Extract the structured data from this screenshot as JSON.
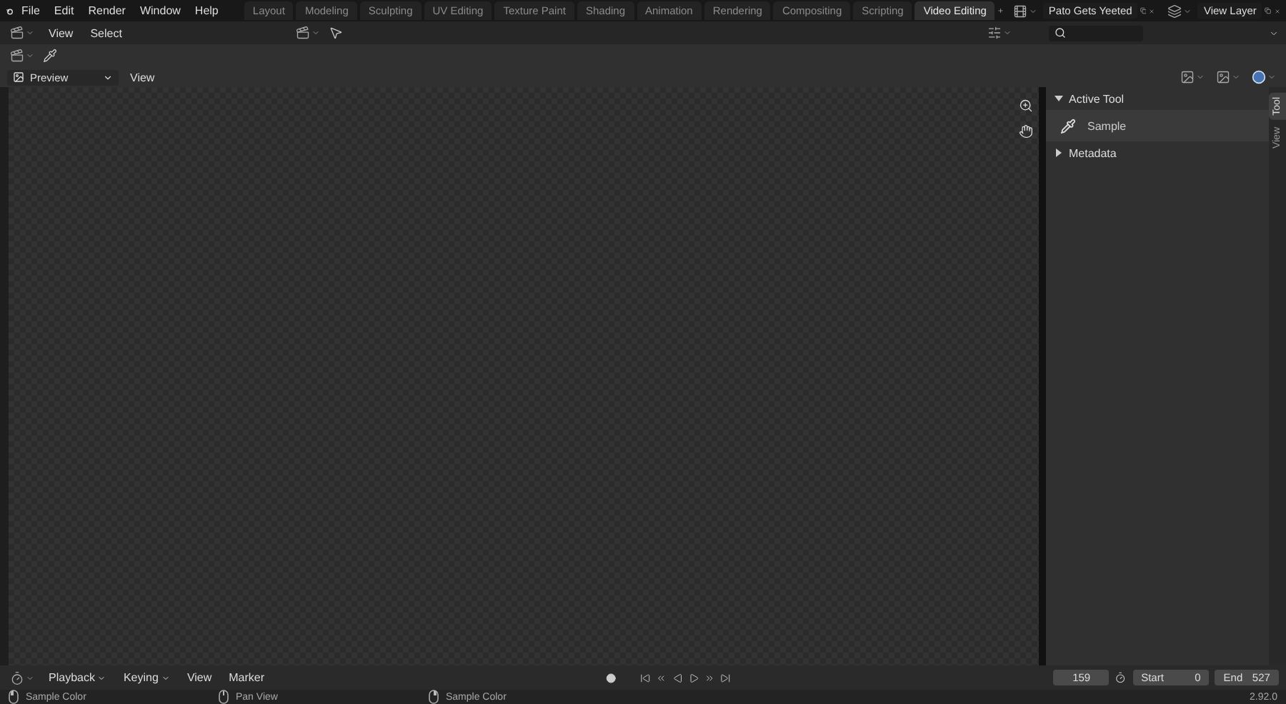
{
  "menu": [
    "File",
    "Edit",
    "Render",
    "Window",
    "Help"
  ],
  "workspaces": [
    {
      "label": "Layout",
      "selected": false
    },
    {
      "label": "Modeling",
      "selected": false
    },
    {
      "label": "Sculpting",
      "selected": false
    },
    {
      "label": "UV Editing",
      "selected": false
    },
    {
      "label": "Texture Paint",
      "selected": false
    },
    {
      "label": "Shading",
      "selected": false
    },
    {
      "label": "Animation",
      "selected": false
    },
    {
      "label": "Rendering",
      "selected": false
    },
    {
      "label": "Compositing",
      "selected": false
    },
    {
      "label": "Scripting",
      "selected": false
    },
    {
      "label": "Video Editing",
      "selected": true
    }
  ],
  "scene": "Pato Gets Yeeted",
  "view_layer": "View Layer",
  "editor_header": {
    "menus": [
      "View",
      "Select"
    ]
  },
  "preview_header": {
    "mode": "Preview",
    "menus": [
      "View"
    ]
  },
  "sidebar": {
    "panels": [
      {
        "title": "Active Tool",
        "expanded": true,
        "items": [
          "Sample"
        ]
      },
      {
        "title": "Metadata",
        "expanded": false
      }
    ],
    "tabs": [
      {
        "label": "Tool",
        "selected": true
      },
      {
        "label": "View",
        "selected": false
      }
    ]
  },
  "timeline": {
    "menus": [
      {
        "label": "Playback",
        "kind": "dropdown"
      },
      {
        "label": "Keying",
        "kind": "dropdown"
      },
      {
        "label": "View",
        "kind": "plain"
      },
      {
        "label": "Marker",
        "kind": "plain"
      }
    ],
    "current_frame": "159",
    "start_label": "Start",
    "start": "0",
    "end_label": "End",
    "end": "527"
  },
  "status_bar": {
    "hints": [
      {
        "kind": "left",
        "text": "Sample Color"
      },
      {
        "kind": "middle",
        "text": "Pan View"
      },
      {
        "kind": "right",
        "text": "Sample Color"
      }
    ],
    "version": "2.92.0"
  }
}
